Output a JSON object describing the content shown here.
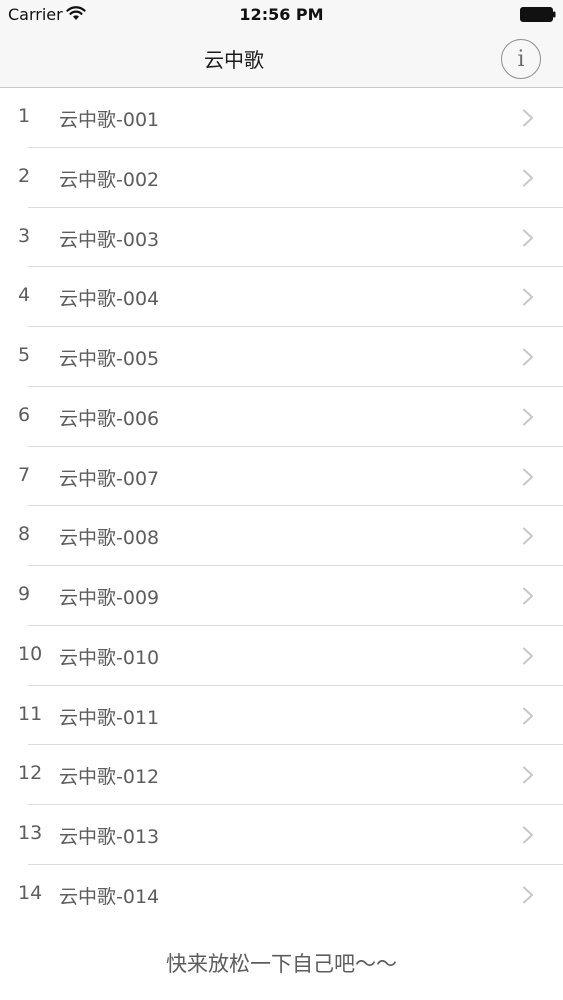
{
  "status_bar": {
    "carrier": "Carrier",
    "time": "12:56 PM",
    "wifi_icon": "wifi-icon",
    "battery_icon": "battery-full-icon"
  },
  "nav": {
    "title": "云中歌",
    "info_icon": "info-circle-icon",
    "info_glyph": "i"
  },
  "list": {
    "items": [
      {
        "num": "1",
        "title": "云中歌-001"
      },
      {
        "num": "2",
        "title": "云中歌-002"
      },
      {
        "num": "3",
        "title": "云中歌-003"
      },
      {
        "num": "4",
        "title": "云中歌-004"
      },
      {
        "num": "5",
        "title": "云中歌-005"
      },
      {
        "num": "6",
        "title": "云中歌-006"
      },
      {
        "num": "7",
        "title": "云中歌-007"
      },
      {
        "num": "8",
        "title": "云中歌-008"
      },
      {
        "num": "9",
        "title": "云中歌-009"
      },
      {
        "num": "10",
        "title": "云中歌-010"
      },
      {
        "num": "11",
        "title": "云中歌-011"
      },
      {
        "num": "12",
        "title": "云中歌-012"
      },
      {
        "num": "13",
        "title": "云中歌-013"
      },
      {
        "num": "14",
        "title": "云中歌-014"
      }
    ],
    "chevron_icon": "chevron-right-icon"
  },
  "footer": {
    "text": "快来放松一下自己吧～～"
  },
  "colors": {
    "bar_background": "#f7f7f7",
    "text": "#5d5d5d",
    "separator": "#dcdcdf",
    "chevron": "#c7c7cc"
  }
}
